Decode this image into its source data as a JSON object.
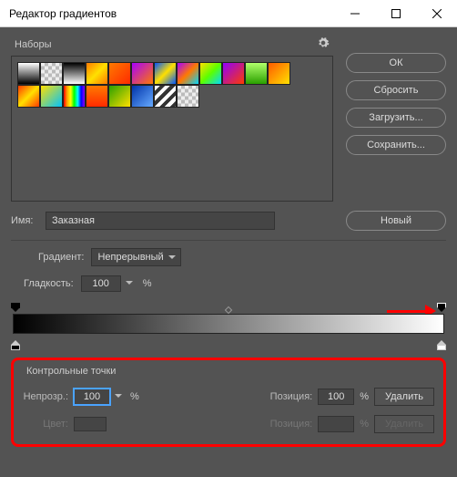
{
  "window": {
    "title": "Редактор градиентов"
  },
  "presets": {
    "label": "Наборы",
    "gear": "settings"
  },
  "buttons": {
    "ok": "ОК",
    "reset": "Сбросить",
    "load": "Загрузить...",
    "save": "Сохранить...",
    "new": "Новый"
  },
  "name": {
    "label": "Имя:",
    "value": "Заказная"
  },
  "gradient": {
    "type_label": "Градиент:",
    "type_value": "Непрерывный",
    "smooth_label": "Гладкость:",
    "smooth_value": "100",
    "smooth_unit": "%"
  },
  "ctrl": {
    "title": "Контрольные точки",
    "opacity_label": "Непрозр.:",
    "opacity_value": "100",
    "opacity_unit": "%",
    "pos1_label": "Позиция:",
    "pos1_value": "100",
    "pos1_unit": "%",
    "del1": "Удалить",
    "color_label": "Цвет:",
    "pos2_label": "Позиция:",
    "pos2_value": "",
    "pos2_unit": "%",
    "del2": "Удалить"
  },
  "swatches": [
    [
      "linear-gradient(to bottom,#fff,#000)",
      "repeating-conic-gradient(#bbb 0 25%,#eee 0 50%) 0/8px 8px,linear-gradient(to bottom,#000,transparent)",
      "linear-gradient(to bottom,#000,#fff)",
      "linear-gradient(135deg,#ff7a00,#ffe000,#ff7a00)",
      "linear-gradient(135deg,#ff7a00,#ff2a00)",
      "linear-gradient(135deg,#a800ff,#ff7a00)",
      "linear-gradient(135deg,#0055ff,#ffe000,#0055ff)",
      "linear-gradient(135deg,#a800ff,#ff7a00,#00d9ff)",
      "linear-gradient(135deg,#ffe000,#5cff00,#00d9ff)",
      "linear-gradient(135deg,#9000ff,#ff3a00)",
      "linear-gradient(to bottom,#b0ff6a,#2aa000)",
      "linear-gradient(135deg,#ff5a00,#ffe000)"
    ],
    [
      "linear-gradient(135deg,#ff3a00,#ffe000,#ff3a00)",
      "linear-gradient(135deg,#ffe000,#00c3ff)",
      "linear-gradient(to right,#ff0000,#ffa500,#ffff00,#00ff00,#00ffff,#0000ff,#8b00ff)",
      "linear-gradient(to bottom,#ff7a00,#ff2a00)",
      "linear-gradient(135deg,#2aa000,#ffe000)",
      "linear-gradient(135deg,#0033aa,#66aaff)",
      "repeating-linear-gradient(135deg,#fff 0 4px,#333 4px 8px)",
      "repeating-conic-gradient(#bbb 0 25%,#eee 0 50%) 0/8px 8px"
    ]
  ]
}
